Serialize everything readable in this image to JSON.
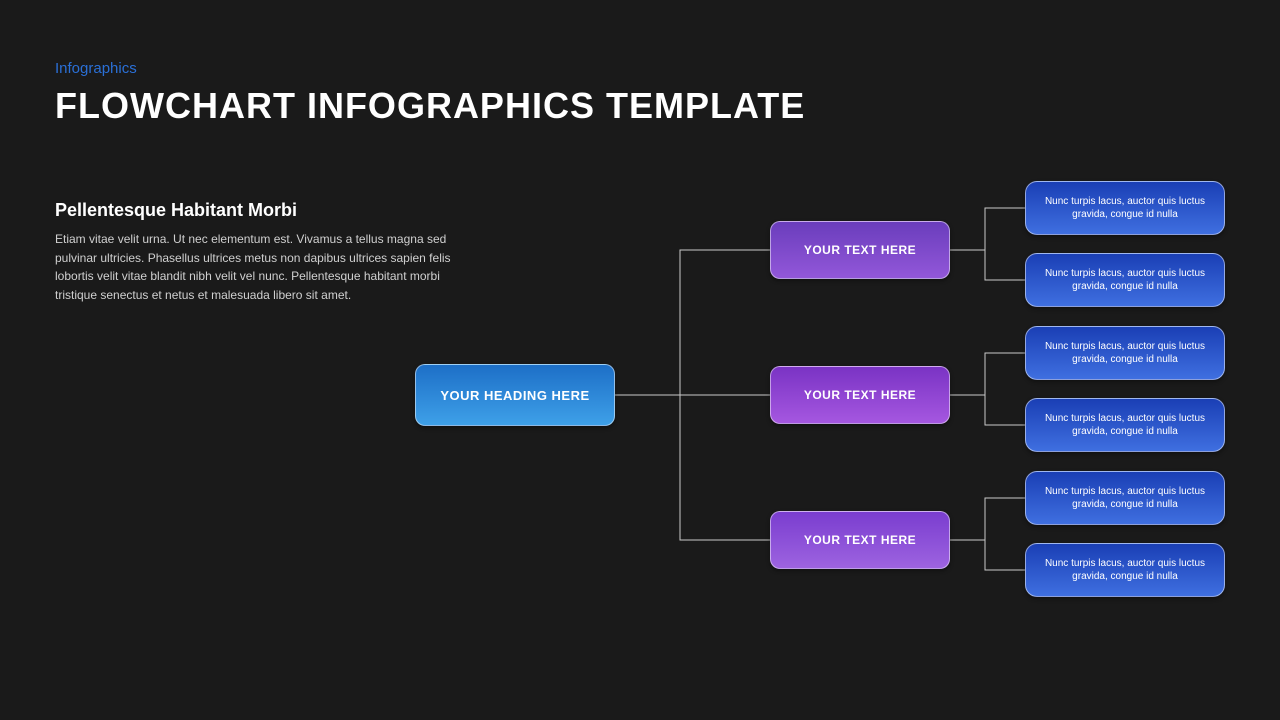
{
  "eyebrow": "Infographics",
  "title": "FLOWCHART INFOGRAPHICS TEMPLATE",
  "subheading": "Pellentesque Habitant Morbi",
  "body": "Etiam vitae velit urna. Ut nec elementum est. Vivamus a tellus magna sed pulvinar ultricies. Phasellus ultrices metus non dapibus ultrices sapien felis lobortis velit vitae blandit nibh velit vel nunc.  Pellentesque habitant morbi tristique senectus et netus et malesuada libero sit amet.",
  "root": {
    "label": "YOUR HEADING HERE"
  },
  "mids": [
    {
      "label": "YOUR TEXT HERE"
    },
    {
      "label": "YOUR TEXT HERE"
    },
    {
      "label": "YOUR TEXT HERE"
    }
  ],
  "leaves": [
    {
      "text": "Nunc turpis lacus, auctor quis luctus gravida, congue id nulla"
    },
    {
      "text": "Nunc turpis lacus, auctor quis luctus gravida, congue id nulla"
    },
    {
      "text": "Nunc turpis lacus, auctor quis luctus gravida, congue id nulla"
    },
    {
      "text": "Nunc turpis lacus, auctor quis luctus gravida, congue id nulla"
    },
    {
      "text": "Nunc turpis lacus, auctor quis luctus gravida, congue id nulla"
    },
    {
      "text": "Nunc turpis lacus, auctor quis luctus gravida, congue id nulla"
    }
  ]
}
